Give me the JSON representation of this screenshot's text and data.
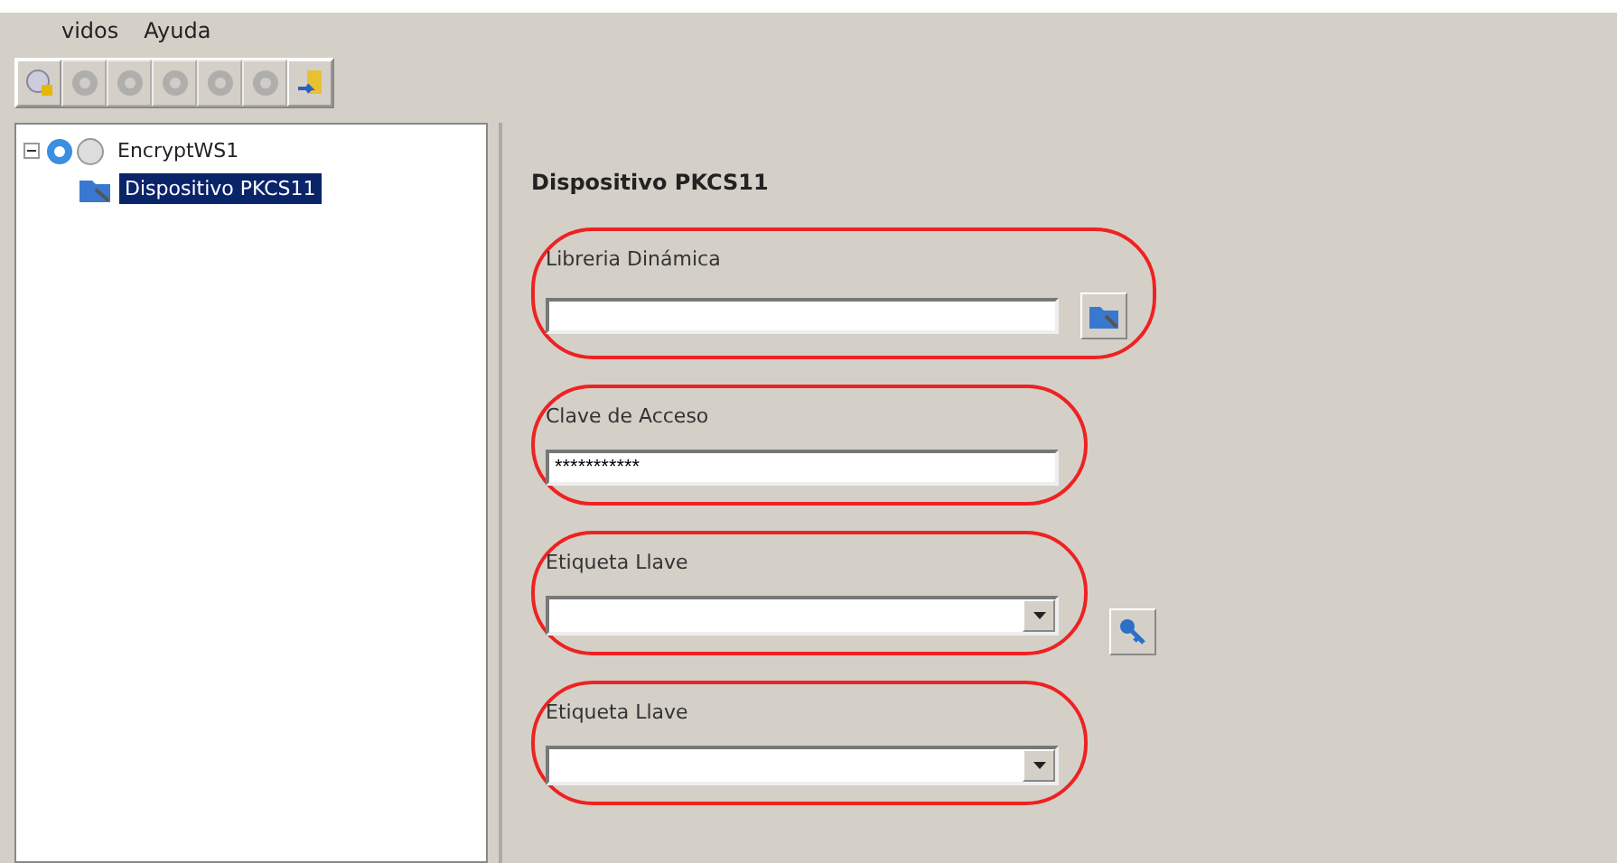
{
  "menu": [
    "vidos",
    "Ayuda"
  ],
  "toolbar": [
    {
      "kind": "connect",
      "disabled": false
    },
    {
      "kind": "gear",
      "disabled": true
    },
    {
      "kind": "gear",
      "disabled": true
    },
    {
      "kind": "gear",
      "disabled": true
    },
    {
      "kind": "gear",
      "disabled": true
    },
    {
      "kind": "gear",
      "disabled": true
    },
    {
      "kind": "exit",
      "disabled": false
    }
  ],
  "tree": [
    {
      "label": "EncryptWS1",
      "expanded": true,
      "selected": false,
      "children": [
        {
          "label": "Dispositivo PKCS11",
          "selected": true
        }
      ]
    }
  ],
  "panel": {
    "title": "Dispositivo PKCS11",
    "fields": [
      {
        "kind": "text",
        "label": "Libreria Dinámica",
        "side_button": {
          "kind": "browse"
        }
      },
      {
        "kind": "text",
        "label": "Clave de Acceso",
        "value": "***********"
      },
      {
        "kind": "combo",
        "label": "Etiqueta Llave",
        "side_button": {
          "kind": "key"
        }
      },
      {
        "kind": "combo",
        "label": "Etiqueta Llave"
      }
    ]
  }
}
